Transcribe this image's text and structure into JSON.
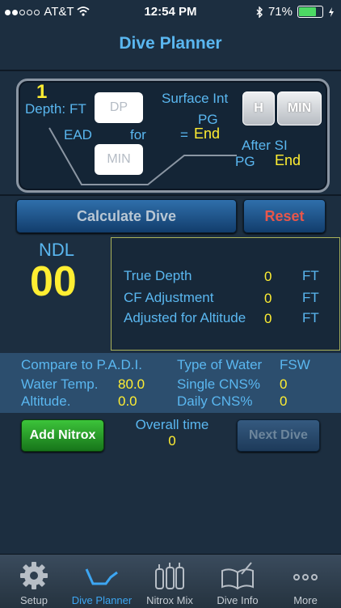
{
  "status": {
    "carrier": "AT&T",
    "time": "12:54 PM",
    "battery": "71%"
  },
  "title": "Dive Planner",
  "profile": {
    "dive_number": "1",
    "depth_label": "Depth:",
    "depth_unit": "FT",
    "depth_placeholder": "DP",
    "surface_int_label": "Surface Int",
    "h_label": "H",
    "min_label": "MIN",
    "ead_label": "EAD",
    "for_label": "for",
    "min_placeholder": "MIN",
    "pg_label": "PG",
    "eq": "=",
    "end_value": "End",
    "after_si": "After SI",
    "pg2_label": "PG",
    "end2_value": "End"
  },
  "buttons": {
    "calculate": "Calculate Dive",
    "reset": "Reset",
    "add_nitrox": "Add Nitrox",
    "next_dive": "Next Dive"
  },
  "ndl": {
    "label": "NDL",
    "value": "00"
  },
  "results": [
    {
      "label": "True Depth",
      "value": "0",
      "unit": "FT"
    },
    {
      "label": "CF Adjustment",
      "value": "0",
      "unit": "FT"
    },
    {
      "label": "Adjusted for Altitude",
      "value": "0",
      "unit": "FT"
    }
  ],
  "settings": {
    "compare": "Compare to P.A.D.I.",
    "water_type_label": "Type of Water",
    "water_type_value": "FSW",
    "water_temp_label": "Water Temp.",
    "water_temp_value": "80.0",
    "single_cns_label": "Single CNS%",
    "single_cns_value": "0",
    "altitude_label": "Altitude.",
    "altitude_value": "0.0",
    "daily_cns_label": "Daily CNS%",
    "daily_cns_value": "0"
  },
  "overall": {
    "label": "Overall time",
    "value": "0"
  },
  "tabs": [
    {
      "label": "Setup",
      "icon": "gear-icon"
    },
    {
      "label": "Dive Planner",
      "icon": "dive-profile-icon"
    },
    {
      "label": "Nitrox Mix",
      "icon": "tanks-icon"
    },
    {
      "label": "Dive Info",
      "icon": "logbook-icon"
    },
    {
      "label": "More",
      "icon": "more-icon"
    }
  ],
  "colors": {
    "accent": "#5ab7f0",
    "highlight": "#ffee32",
    "background": "#1c2e40"
  }
}
